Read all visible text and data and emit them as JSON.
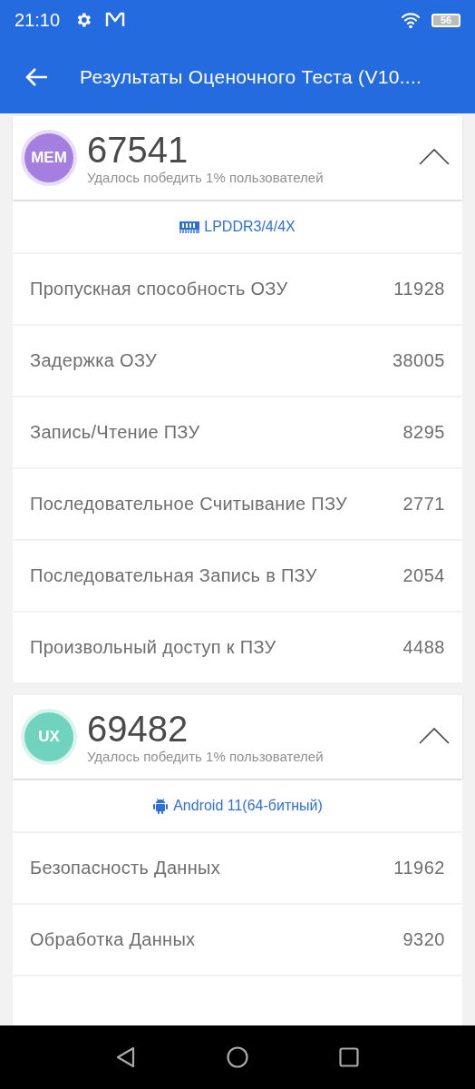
{
  "status_bar": {
    "time": "21:10",
    "battery": "56"
  },
  "app_bar": {
    "title": "Результаты Оценочного Теста (V10...."
  },
  "sections": [
    {
      "badge": "MEM",
      "color": "#a57fe0",
      "score": "67541",
      "subtitle": "Удалось победить 1% пользователей",
      "expanded": true,
      "chip": {
        "kind": "ram",
        "label": "LPDDR3/4/4X"
      },
      "rows": [
        {
          "label": "Пропускная способность ОЗУ",
          "value": "11928"
        },
        {
          "label": "Задержка ОЗУ",
          "value": "38005"
        },
        {
          "label": "Запись/Чтение ПЗУ",
          "value": "8295"
        },
        {
          "label": "Последовательное Считывание ПЗУ",
          "value": "2771"
        },
        {
          "label": "Последовательная Запись в ПЗУ",
          "value": "2054"
        },
        {
          "label": "Произвольный доступ к ПЗУ",
          "value": "4488"
        }
      ]
    },
    {
      "badge": "UX",
      "color": "#6fd3bd",
      "score": "69482",
      "subtitle": "Удалось победить 1% пользователей",
      "expanded": true,
      "chip": {
        "kind": "android",
        "label": "Android 11(64-битный)"
      },
      "rows": [
        {
          "label": "Безопасность Данных",
          "value": "11962"
        },
        {
          "label": "Обработка Данных",
          "value": "9320"
        }
      ]
    }
  ]
}
